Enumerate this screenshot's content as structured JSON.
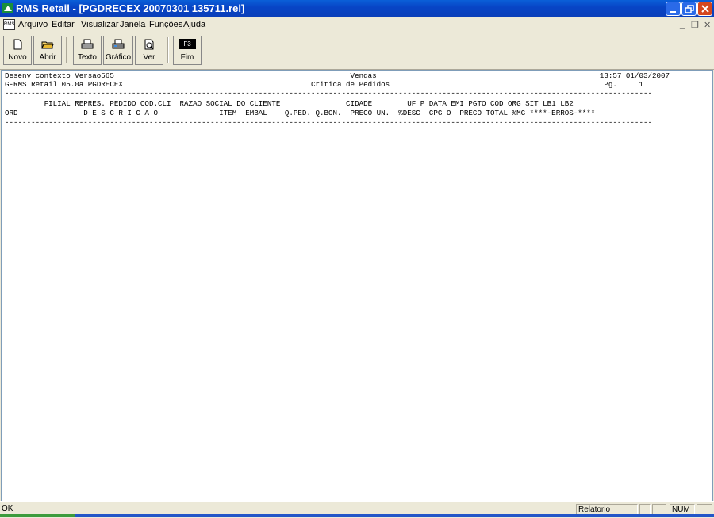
{
  "window": {
    "title": "RMS Retail - [PGDRECEX 20070301 135711.rel]"
  },
  "menu": {
    "icon_text": "RMS",
    "items": [
      "Arquivo",
      "Editar",
      "Visualizar",
      "Janela",
      "Funções",
      "Ajuda"
    ],
    "mdi_controls": [
      "_",
      "❐",
      "✕"
    ]
  },
  "toolbar": {
    "buttons": [
      {
        "label": "Novo",
        "icon": "new-document-icon"
      },
      {
        "label": "Abrir",
        "icon": "open-folder-icon"
      },
      {
        "label": "Texto",
        "icon": "printer-icon"
      },
      {
        "label": "Gráfico",
        "icon": "printer-graphic-icon"
      },
      {
        "label": "Ver",
        "icon": "print-preview-icon"
      },
      {
        "label": "Fim",
        "icon": "f3-key-icon",
        "key_text": "F3"
      }
    ]
  },
  "report": {
    "lines": [
      "Desenv contexto Versao565                                                      Vendas                                                   13:57 01/03/2007",
      "G-RMS Retail 05.0a PGDRECEX                                           Critica de Pedidos                                                 Pg.     1",
      "----------------------------------------------------------------------------------------------------------------------------------------------------",
      "         FILIAL REPRES. PEDIDO COD.CLI  RAZAO SOCIAL DO CLIENTE               CIDADE        UF P DATA EMI PGTO COD ORG SIT LB1 LB2",
      "ORD               D E S C R I C A O              ITEM  EMBAL    Q.PED. Q.BON.  PRECO UN.  %DESC  CPG O  PRECO TOTAL %MG ****-ERROS-****",
      "----------------------------------------------------------------------------------------------------------------------------------------------------"
    ]
  },
  "statusbar": {
    "left": "OK",
    "panel_relatorio": "Relatorio",
    "panel_empty": "",
    "panel_num": "NUM"
  }
}
